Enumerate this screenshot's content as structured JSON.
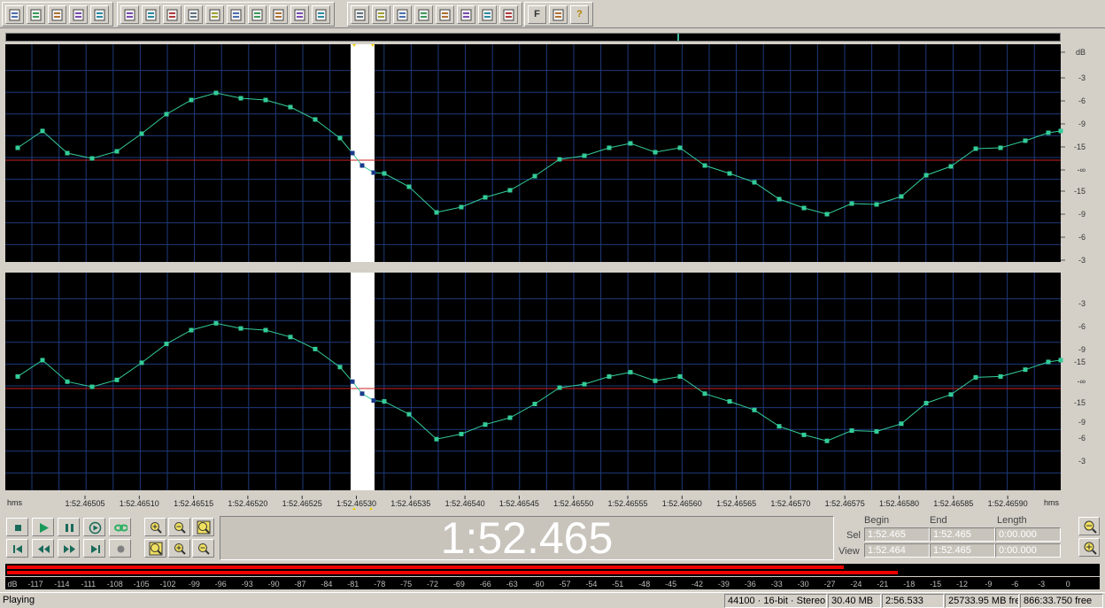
{
  "toolbar": {
    "groups": [
      [
        "new-file-icon",
        "open-file-icon",
        "save-icon",
        "save-as-icon",
        "save-all-icon"
      ],
      [
        "undo-icon",
        "redo-icon",
        "repeat-icon",
        "batch-icon",
        "copy-icon",
        "cut-icon",
        "paste-icon",
        "paste-new-icon",
        "mix-icon",
        "trim-icon"
      ],
      [
        "envelope-icon",
        "region-icon",
        "cue-list-icon",
        "playlist-icon",
        "markers-icon",
        "cd-icon",
        "plugin-icon",
        "cd-burn-icon"
      ],
      [
        "favorites-icon",
        "settings-icon",
        "help-icon"
      ]
    ],
    "text_buttons": {
      "favorites": "F",
      "help": "?"
    }
  },
  "waveform": {
    "channels": 2,
    "db_labels": [
      "dB",
      "-3",
      "-6",
      "-9",
      "-15",
      "-∞",
      "-15",
      "-9",
      "-6",
      "-3"
    ],
    "db_labels_lower": [
      "-3",
      "-6",
      "-9",
      "-15",
      "-∞",
      "-15",
      "-9",
      "-6",
      "-3"
    ],
    "selection_start_label": "1:52.46530",
    "colors": {
      "background": "#000000",
      "wave": "#33cc99",
      "grid": "#1e3a7a",
      "center_line": "#cc2222",
      "selection": "#ffffff"
    }
  },
  "timeline": {
    "unit": "hms",
    "unit_right": "hms",
    "ticks": [
      "1:52.46505",
      "1:52.46510",
      "1:52.46515",
      "1:52.46520",
      "1:52.46525",
      "1:52.46530",
      "1:52.46535",
      "1:52.46540",
      "1:52.46545",
      "1:52.46550",
      "1:52.46555",
      "1:52.46560",
      "1:52.46565",
      "1:52.46570",
      "1:52.46575",
      "1:52.46580",
      "1:52.46585",
      "1:52.46590"
    ]
  },
  "transport": {
    "buttons": [
      "stop-icon",
      "play-icon",
      "pause-icon",
      "play-all-icon",
      "loop-icon",
      "go-start-icon",
      "rewind-icon",
      "fast-forward-icon",
      "go-end-icon",
      "record-icon"
    ]
  },
  "zoom": {
    "buttons": [
      "zoom-in-icon",
      "zoom-out-icon",
      "zoom-full-icon",
      "zoom-selection-icon",
      "zoom-in-vertical-icon",
      "zoom-out-vertical-icon"
    ]
  },
  "time_display": "1:52.465",
  "selection": {
    "headers": {
      "begin": "Begin",
      "end": "End",
      "length": "Length"
    },
    "rows": [
      {
        "label": "Sel",
        "begin": "1:52.465",
        "end": "1:52.465",
        "length": "0:00.000"
      },
      {
        "label": "View",
        "begin": "1:52.464",
        "end": "1:52.465",
        "length": "0:00.000"
      }
    ]
  },
  "meter": {
    "levels": [
      0.78,
      0.83
    ],
    "scale": [
      "dB",
      "-117",
      "-114",
      "-111",
      "-108",
      "-105",
      "-102",
      "-99",
      "-96",
      "-93",
      "-90",
      "-87",
      "-84",
      "-81",
      "-78",
      "-75",
      "-72",
      "-69",
      "-66",
      "-63",
      "-60",
      "-57",
      "-54",
      "-51",
      "-48",
      "-45",
      "-42",
      "-39",
      "-36",
      "-33",
      "-30",
      "-27",
      "-24",
      "-21",
      "-18",
      "-15",
      "-12",
      "-9",
      "-6",
      "-3",
      "0"
    ]
  },
  "status": {
    "state": "Playing",
    "format": "44100 · 16-bit · Stereo",
    "size": "30.40 MB",
    "duration": "2:56.533",
    "free_mb": "25733.95 MB fre",
    "free_time": "866:33.750 free"
  }
}
